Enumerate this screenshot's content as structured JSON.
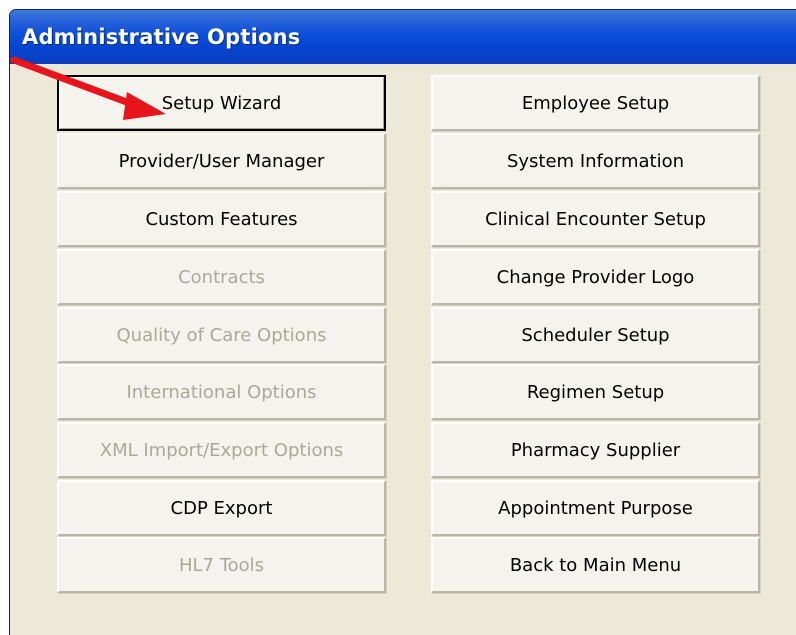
{
  "window": {
    "title": "Administrative Options"
  },
  "left_buttons": [
    {
      "label": "Setup Wizard",
      "enabled": true,
      "focused": true
    },
    {
      "label": "Provider/User Manager",
      "enabled": true
    },
    {
      "label": "Custom Features",
      "enabled": true
    },
    {
      "label": "Contracts",
      "enabled": false
    },
    {
      "label": "Quality of Care Options",
      "enabled": false
    },
    {
      "label": "International Options",
      "enabled": false
    },
    {
      "label": "XML Import/Export Options",
      "enabled": false
    },
    {
      "label": "CDP Export",
      "enabled": true
    },
    {
      "label": "HL7 Tools",
      "enabled": false
    }
  ],
  "right_buttons": [
    {
      "label": "Employee Setup",
      "enabled": true
    },
    {
      "label": "System Information",
      "enabled": true
    },
    {
      "label": "Clinical Encounter Setup",
      "enabled": true
    },
    {
      "label": "Change Provider Logo",
      "enabled": true
    },
    {
      "label": "Scheduler Setup",
      "enabled": true
    },
    {
      "label": "Regimen Setup",
      "enabled": true
    },
    {
      "label": "Pharmacy Supplier",
      "enabled": true
    },
    {
      "label": "Appointment Purpose",
      "enabled": true
    },
    {
      "label": "Back to Main Menu",
      "enabled": true
    }
  ],
  "annotation": {
    "arrow_color": "#e8141c"
  }
}
